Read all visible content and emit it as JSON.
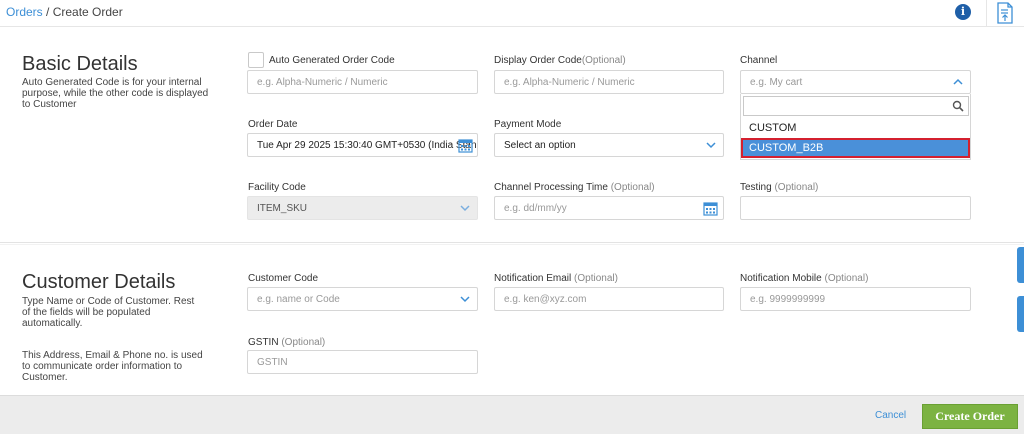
{
  "breadcrumb": {
    "parent": "Orders",
    "separator": " / ",
    "current": "Create Order"
  },
  "basic": {
    "title": "Basic Details",
    "description": "Auto Generated Code is for your internal purpose, while the other code is displayed to Customer",
    "auto_code_label": "Auto Generated Order Code",
    "auto_code_placeholder": "e.g. Alpha-Numeric / Numeric",
    "display_code_label": "Display Order Code",
    "display_code_optional": "(Optional)",
    "display_code_placeholder": "e.g. Alpha-Numeric / Numeric",
    "channel_label": "Channel",
    "channel_placeholder": "e.g. My cart",
    "channel_options": [
      "CUSTOM",
      "CUSTOM_B2B"
    ],
    "order_date_label": "Order Date",
    "order_date_value": "Tue Apr 29 2025 15:30:40 GMT+0530 (India Stan",
    "payment_label": "Payment Mode",
    "payment_value": "Select an option",
    "facility_label": "Facility Code",
    "facility_value": "ITEM_SKU",
    "cpt_label": "Channel Processing Time",
    "cpt_optional": " (Optional)",
    "cpt_placeholder": "e.g. dd/mm/yy",
    "testing_label": "Testing",
    "testing_optional": " (Optional)"
  },
  "customer": {
    "title": "Customer Details",
    "description": "Type Name or Code of Customer. Rest of the fields will be populated automatically.",
    "description2": "This Address, Email & Phone no. is used to communicate order information to Customer.",
    "code_label": "Customer Code",
    "code_placeholder": "e.g. name or Code",
    "email_label": "Notification Email",
    "email_optional": " (Optional)",
    "email_placeholder": "e.g. ken@xyz.com",
    "mobile_label": "Notification Mobile",
    "mobile_optional": " (Optional)",
    "mobile_placeholder": "e.g. 9999999999",
    "gstin_label": "GSTIN",
    "gstin_optional": " (Optional)",
    "gstin_placeholder": "GSTIN"
  },
  "footer": {
    "cancel_label": "Cancel",
    "create_label": "Create Order"
  },
  "colors": {
    "accent": "#3d8fd6",
    "create": "#7cb342",
    "highlight": "#4a90d9",
    "outline": "#d4202f"
  }
}
